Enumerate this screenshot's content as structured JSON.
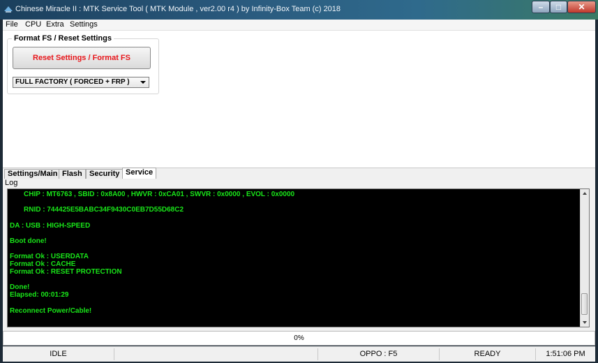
{
  "window": {
    "title": "Chinese Miracle II : MTK Service Tool ( MTK Module , ver2.00 r4  ) by Infinity-Box Team (c) 2018",
    "minimize": "–",
    "maximize": "□",
    "close": "✕"
  },
  "menu": [
    "File",
    "CPU",
    "Extra",
    "Settings"
  ],
  "format_group": {
    "label": "Format FS / Reset Settings",
    "button": "Reset Settings / Format FS",
    "selected_mode": "FULL FACTORY ( FORCED + FRP )"
  },
  "tabs": [
    "Settings/Main",
    "Flash",
    "Security",
    "Service"
  ],
  "active_tab": "Service",
  "log": {
    "label": "Log",
    "lines": [
      "CHIP : MT6763 , SBID : 0x8A00 , HWVR : 0xCA01 , SWVR : 0x0000 , EVOL : 0x0000",
      "RNID : 744425E5BABC34F9430C0EB7D55D68C2",
      "DA : USB : HIGH-SPEED",
      "Boot done!",
      "Format Ok : USERDATA",
      "Format Ok : CACHE",
      "Format Ok : RESET PROTECTION",
      "Done!",
      "Elapsed: 00:01:29",
      "Reconnect Power/Cable!"
    ]
  },
  "progress": {
    "value": 0,
    "label": "0%"
  },
  "status": {
    "state": "IDLE",
    "device": "OPPO : F5",
    "ready": "READY",
    "time": "1:51:06 PM"
  },
  "colors": {
    "log_text": "#19e619",
    "log_background": "#000000",
    "reset_button_text": "#e8161b"
  }
}
